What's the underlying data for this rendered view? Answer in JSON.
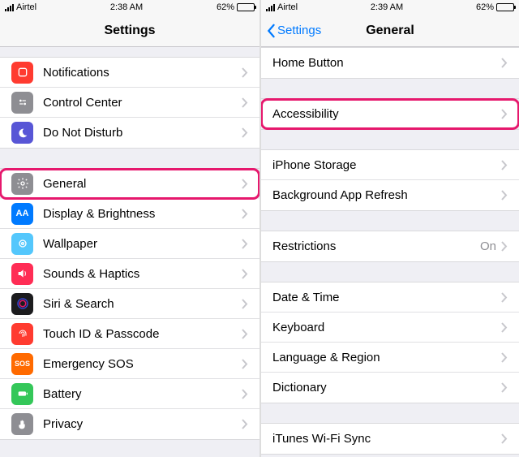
{
  "left": {
    "status": {
      "carrier": "Airtel",
      "time": "2:38 AM",
      "battery": "62%"
    },
    "title": "Settings",
    "rows": [
      {
        "label": "Notifications"
      },
      {
        "label": "Control Center"
      },
      {
        "label": "Do Not Disturb"
      },
      {
        "label": "General"
      },
      {
        "label": "Display & Brightness"
      },
      {
        "label": "Wallpaper"
      },
      {
        "label": "Sounds & Haptics"
      },
      {
        "label": "Siri & Search"
      },
      {
        "label": "Touch ID & Passcode"
      },
      {
        "label": "Emergency SOS"
      },
      {
        "label": "Battery"
      },
      {
        "label": "Privacy"
      }
    ]
  },
  "right": {
    "status": {
      "carrier": "Airtel",
      "time": "2:39 AM",
      "battery": "62%"
    },
    "back": "Settings",
    "title": "General",
    "rows": [
      {
        "label": "Home Button"
      },
      {
        "label": "Accessibility"
      },
      {
        "label": "iPhone Storage"
      },
      {
        "label": "Background App Refresh"
      },
      {
        "label": "Restrictions",
        "value": "On"
      },
      {
        "label": "Date & Time"
      },
      {
        "label": "Keyboard"
      },
      {
        "label": "Language & Region"
      },
      {
        "label": "Dictionary"
      },
      {
        "label": "iTunes Wi-Fi Sync"
      }
    ]
  }
}
